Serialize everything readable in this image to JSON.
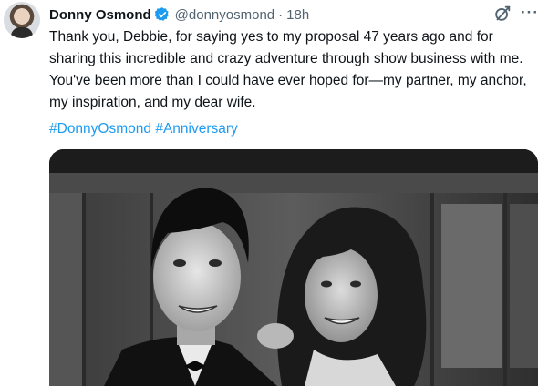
{
  "author": {
    "name": "Donny Osmond",
    "handle": "@donnyosmond",
    "separator": "·",
    "time": "18h",
    "verified_color": "#1d9bf0"
  },
  "actions": {
    "grok_icon": "grok-icon",
    "more_label": "···"
  },
  "tweet": {
    "lines": [
      "Thank you, Debbie, for saying yes to my proposal 47 years ago and for",
      "sharing this incredible and crazy adventure through show business with me.",
      "You've been more than I could have ever hoped for—my partner, my anchor,",
      "my inspiration, and my dear wife."
    ],
    "hashtags": [
      "#DonnyOsmond",
      "#Anniversary"
    ]
  },
  "media": {
    "type": "black-and-white photo",
    "subjects": [
      "man in tuxedo with bow tie",
      "woman with curly hair"
    ]
  },
  "colors": {
    "link": "#1d9bf0",
    "text": "#0f1419",
    "secondary": "#536471"
  }
}
